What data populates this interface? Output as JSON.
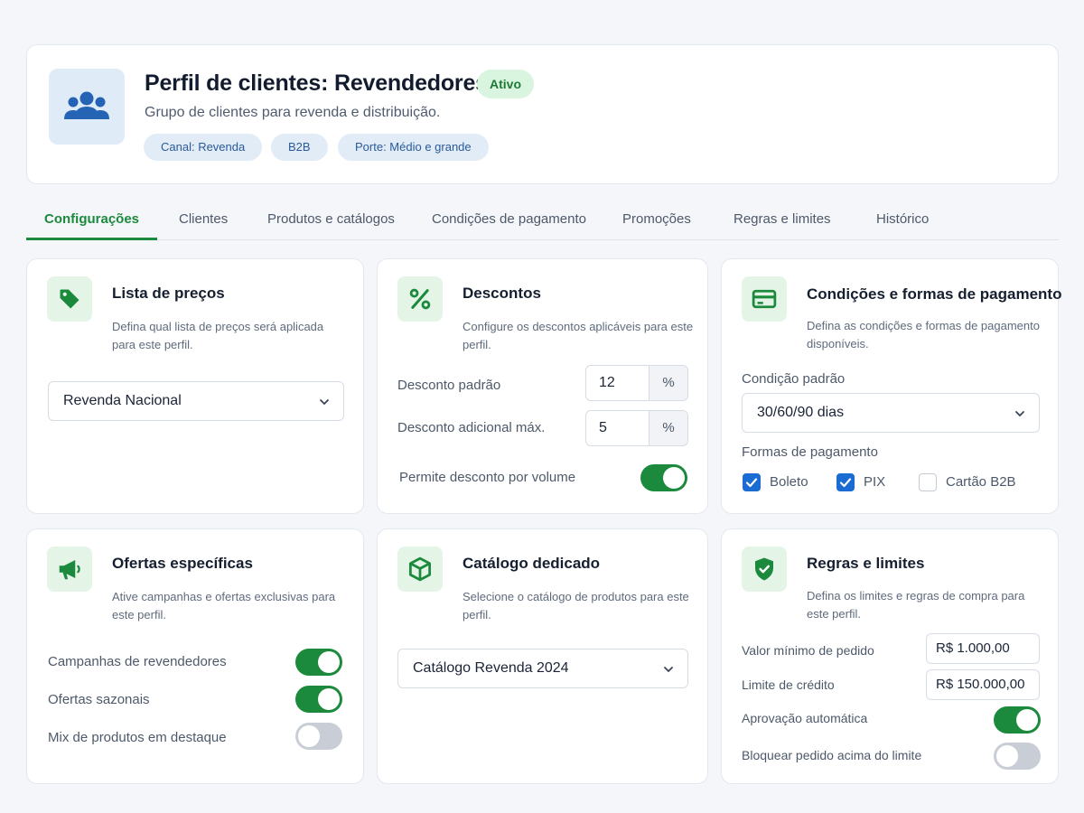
{
  "header": {
    "title": "Perfil de clientes: Revendedores",
    "status": "Ativo",
    "subtitle": "Grupo de clientes para revenda e distribuição.",
    "tags": [
      "Canal: Revenda",
      "B2B",
      "Porte: Médio e grande"
    ],
    "icon": "users-group-icon"
  },
  "tabs": [
    {
      "label": "Configurações",
      "active": true
    },
    {
      "label": "Clientes",
      "active": false
    },
    {
      "label": "Produtos e catálogos",
      "active": false
    },
    {
      "label": "Condições de pagamento",
      "active": false
    },
    {
      "label": "Promoções",
      "active": false
    },
    {
      "label": "Regras e limites",
      "active": false
    },
    {
      "label": "Histórico",
      "active": false
    }
  ],
  "price_list": {
    "title": "Lista de preços",
    "description": "Defina qual lista de preços será aplicada para este perfil.",
    "selected": "Revenda Nacional",
    "icon": "price-tag-icon"
  },
  "discounts": {
    "title": "Descontos",
    "description": "Configure os descontos aplicáveis para este perfil.",
    "default_label": "Desconto padrão",
    "default_value": "12",
    "max_label": "Desconto adicional máx.",
    "max_value": "5",
    "unit": "%",
    "volume_label": "Permite desconto por volume",
    "volume_enabled": true,
    "icon": "percent-icon"
  },
  "payment": {
    "title": "Condições e formas de pagamento",
    "description": "Defina as condições e formas de pagamento disponíveis.",
    "condition_label": "Condição padrão",
    "condition_selected": "30/60/90 dias",
    "methods_label": "Formas de pagamento",
    "methods": [
      {
        "label": "Boleto",
        "checked": true
      },
      {
        "label": "PIX",
        "checked": true
      },
      {
        "label": "Cartão B2B",
        "checked": false
      }
    ],
    "icon": "credit-card-icon"
  },
  "offers": {
    "title": "Ofertas específicas",
    "description": "Ative campanhas e ofertas exclusivas para este perfil.",
    "items": [
      {
        "label": "Campanhas de revendedores",
        "enabled": true
      },
      {
        "label": "Ofertas sazonais",
        "enabled": true
      },
      {
        "label": "Mix de produtos em destaque",
        "enabled": false
      }
    ],
    "icon": "megaphone-icon"
  },
  "catalog": {
    "title": "Catálogo dedicado",
    "description": "Selecione o catálogo de produtos para este perfil.",
    "selected": "Catálogo Revenda 2024",
    "icon": "box-icon"
  },
  "rules": {
    "title": "Regras e limites",
    "description": "Defina os limites e regras de compra para este perfil.",
    "min_order_label": "Valor mínimo de pedido",
    "min_order_value": "R$ 1.000,00",
    "credit_label": "Limite de crédito",
    "credit_value": "R$ 150.000,00",
    "auto_approval_label": "Aprovação automática",
    "auto_approval": true,
    "block_label": "Bloquear pedido acima do limite",
    "block_enabled": false,
    "icon": "shield-check-icon"
  },
  "colors": {
    "accent": "#1c8a3c",
    "check": "#1a6bd2",
    "badge_bg": "#d9f4df"
  }
}
